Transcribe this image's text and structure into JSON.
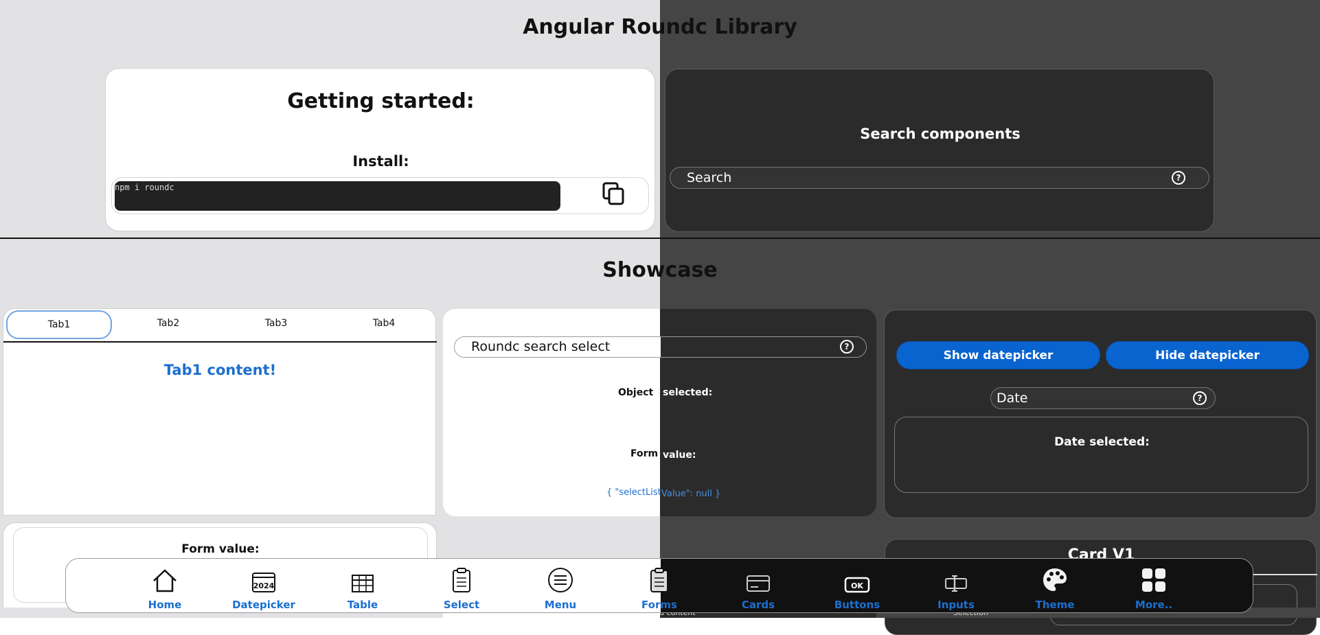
{
  "header": {
    "title": "Angular Roundc Library"
  },
  "getting_started": {
    "title": "Getting started:",
    "install_label": "Install:",
    "command": "npm i roundc",
    "copy_icon": "copy-icon"
  },
  "search_components": {
    "title": "Search components",
    "placeholder": "Search",
    "help_icon": "help-icon"
  },
  "showcase": {
    "title": "Showcase"
  },
  "tabs_demo": {
    "tabs": [
      {
        "label": "Tab1",
        "active": true
      },
      {
        "label": "Tab2",
        "active": false
      },
      {
        "label": "Tab3",
        "active": false
      },
      {
        "label": "Tab4",
        "active": false
      }
    ],
    "content": "Tab1 content!"
  },
  "select_demo": {
    "placeholder": "Roundc search select",
    "object_label_left": "Object",
    "object_label_right": "selected:",
    "form_label_left": "Form",
    "form_label_right": "value:",
    "json_left": "{ \"selectList",
    "json_right": "Value\": null }"
  },
  "datepicker_demo": {
    "show_label": "Show datepicker",
    "hide_label": "Hide datepicker",
    "date_placeholder": "Date",
    "date_selected_label": "Date selected:"
  },
  "form_card": {
    "label": "Form value:"
  },
  "card_v1": {
    "title": "Card V1",
    "partial_text": "d content",
    "partial_text2": "Selection"
  },
  "bottom_nav": {
    "items": [
      {
        "label": "Home",
        "icon": "home-icon"
      },
      {
        "label": "Datepicker",
        "icon": "calendar-icon",
        "icon_text": "2024"
      },
      {
        "label": "Table",
        "icon": "table-icon"
      },
      {
        "label": "Select",
        "icon": "clipboard-icon"
      },
      {
        "label": "Menu",
        "icon": "menu-icon"
      },
      {
        "label": "Forms",
        "icon": "form-clipboard-icon"
      },
      {
        "label": "Cards",
        "icon": "card-icon"
      },
      {
        "label": "Buttons",
        "icon": "ok-button-icon",
        "icon_text": "OK"
      },
      {
        "label": "Inputs",
        "icon": "input-icon"
      },
      {
        "label": "Theme",
        "icon": "palette-icon"
      },
      {
        "label": "More..",
        "icon": "grid-icon"
      }
    ]
  },
  "colors": {
    "light_bg": "#e2e2e4",
    "dark_bg": "#454545",
    "dark_panel": "#2b2b2b",
    "accent_blue": "#0a64cf",
    "link_blue": "#1c6fd0"
  }
}
